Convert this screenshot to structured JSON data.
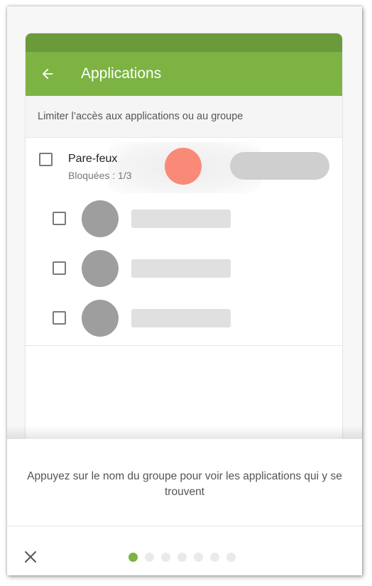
{
  "app_bar": {
    "title": "Applications"
  },
  "subheader": {
    "text": "Limiter l’accès aux applications ou au groupe"
  },
  "group": {
    "name": "Pare-feux",
    "status": "Bloquées : 1/3"
  },
  "apps": [
    {
      "checked": false
    },
    {
      "checked": false
    },
    {
      "checked": false
    }
  ],
  "tutorial": {
    "message": "Appuyez sur le nom du groupe pour voir les applications qui y se trouvent",
    "page_count": 7,
    "current_page": 1
  },
  "colors": {
    "accent": "#7cb342",
    "status_bar": "#6a9a3a",
    "tap_indicator": "#fa8a78"
  },
  "icons": {
    "back": "arrow-left-icon",
    "close": "close-icon"
  }
}
